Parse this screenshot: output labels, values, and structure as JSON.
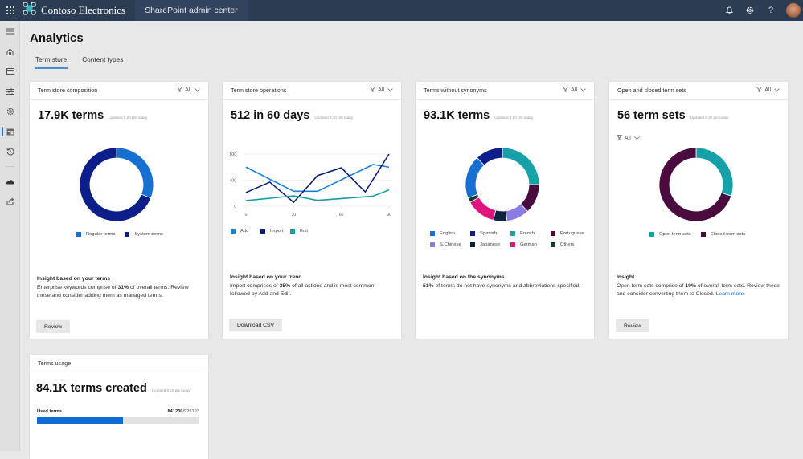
{
  "topbar": {
    "brand_name": "Contoso Electronics",
    "app_name": "SharePoint admin center",
    "brand_color": "#2b3c53",
    "icons": [
      "app-launcher-icon",
      "notifications-icon",
      "settings-icon",
      "help-icon",
      "avatar"
    ]
  },
  "leftnav": {
    "items": [
      "menu-icon",
      "home-icon",
      "sites-icon",
      "policies-icon",
      "settings-icon",
      "content-services-icon",
      "migration-icon",
      "onedrive-icon",
      "more-features-icon"
    ],
    "active": "content-services-icon"
  },
  "page": {
    "title": "Analytics",
    "tabs": [
      {
        "label": "Term store",
        "active": true
      },
      {
        "label": "Content types",
        "active": false
      }
    ]
  },
  "cards": {
    "composition": {
      "title": "Term store composition",
      "filter": "All",
      "metric": "17.9K terms",
      "updated": "Updated 6:20 pm today",
      "insight_title": "Insight based on your terms",
      "insight_pre": "Enterprise keywords comprise of ",
      "insight_bold": "31%",
      "insight_post": " of overall terms. Review these and consider adding them as managed terms.",
      "button": "Review"
    },
    "operations": {
      "title": "Term store operations",
      "filter": "All",
      "metric": "512 in 60 days",
      "updated": "Updated 6:20 pm today",
      "insight_title": "Insight based on your trend",
      "insight_pre": "Import comprises of ",
      "insight_bold": "35%",
      "insight_post": " of all actions and is most common, followed by Add and Edit.",
      "button": "Download CSV"
    },
    "synonyms": {
      "title": "Terms without synonyms",
      "filter": "All",
      "metric": "93.1K terms",
      "updated": "Updated 6:20 pm today",
      "insight_title": "Insight based on the synonyms",
      "insight_bold": "51%",
      "insight_post": " of terms do not have synonyms and abbreviations specified."
    },
    "termsets": {
      "title": "Open and closed term sets",
      "filter": "All",
      "metric": "56 term sets",
      "updated": "Updated 6:20 pm today",
      "sub_filter": "All",
      "insight_title": "Insight",
      "insight_pre": "Open term sets comprise of ",
      "insight_bold": "19%",
      "insight_post": " of overall term sets. Review these and consider converting them to Closed. ",
      "insight_link": "Learn more.",
      "button": "Review"
    },
    "usage": {
      "title": "Terms usage",
      "metric": "84.1K terms created",
      "updated": "Updated 6:20 pm today",
      "bar_label": "Used terms",
      "used": "841230",
      "total": "/926193",
      "progress": 0.53
    }
  },
  "chart_data": [
    {
      "type": "pie",
      "title": "Term store composition",
      "donut": true,
      "categories": [
        "Regular terms",
        "System terms"
      ],
      "values": [
        31,
        69
      ],
      "colors": [
        "#1570d2",
        "#0b1e8a"
      ]
    },
    {
      "type": "line",
      "title": "Term store operations",
      "xlim": [
        0,
        90
      ],
      "ylim": [
        0,
        800
      ],
      "xticks": [
        0,
        30,
        60,
        90
      ],
      "yticks": [
        0,
        400,
        800
      ],
      "grid": true,
      "legend": "bottom-left",
      "series": [
        {
          "name": "Add",
          "color": "#1a7fd6",
          "x": [
            0,
            30,
            45,
            80,
            90
          ],
          "values": [
            600,
            230,
            230,
            640,
            600
          ]
        },
        {
          "name": "Import",
          "color": "#0b1e7a",
          "x": [
            0,
            15,
            30,
            45,
            60,
            75,
            90
          ],
          "values": [
            210,
            370,
            60,
            470,
            590,
            220,
            800
          ]
        },
        {
          "name": "Edit",
          "color": "#12a0a6",
          "x": [
            0,
            30,
            45,
            80,
            90
          ],
          "values": [
            85,
            160,
            90,
            155,
            250
          ]
        }
      ]
    },
    {
      "type": "pie",
      "title": "Terms without synonyms",
      "donut": true,
      "categories": [
        "French",
        "Portuguese",
        "S.Chinese",
        "Japanese",
        "German",
        "Others",
        "English",
        "Spanish"
      ],
      "values": [
        25,
        13,
        10,
        6,
        13,
        2,
        19,
        12
      ],
      "colors": [
        "#16a0a8",
        "#4a0c3e",
        "#8c7be0",
        "#0c2340",
        "#e0147f",
        "#0e3a2e",
        "#1570d2",
        "#0b1e8a"
      ],
      "legend_order": [
        "English",
        "Spanish",
        "French",
        "Portuguese",
        "S.Chinese",
        "Japanese",
        "German",
        "Others"
      ]
    },
    {
      "type": "pie",
      "title": "Open and closed term sets",
      "donut": true,
      "categories": [
        "Open term sets",
        "Closed term sets"
      ],
      "values": [
        30,
        70
      ],
      "colors": [
        "#16a0a8",
        "#4a0c3e"
      ]
    }
  ]
}
